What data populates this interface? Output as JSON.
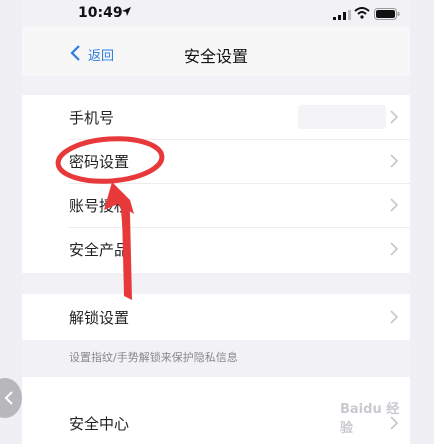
{
  "status_bar": {
    "time": "10:49"
  },
  "nav": {
    "back_label": "返回",
    "title": "安全设置"
  },
  "group1": {
    "rows": [
      {
        "label": "手机号"
      },
      {
        "label": "密码设置"
      },
      {
        "label": "账号授权"
      },
      {
        "label": "安全产品"
      }
    ]
  },
  "group2": {
    "rows": [
      {
        "label": "解锁设置"
      }
    ],
    "hint": "设置指纹/手势解锁来保护隐私信息"
  },
  "group3": {
    "rows": [
      {
        "label": "安全中心"
      }
    ]
  },
  "annotation": {
    "color": "#e8393a"
  },
  "watermark": "Baidu 经验"
}
